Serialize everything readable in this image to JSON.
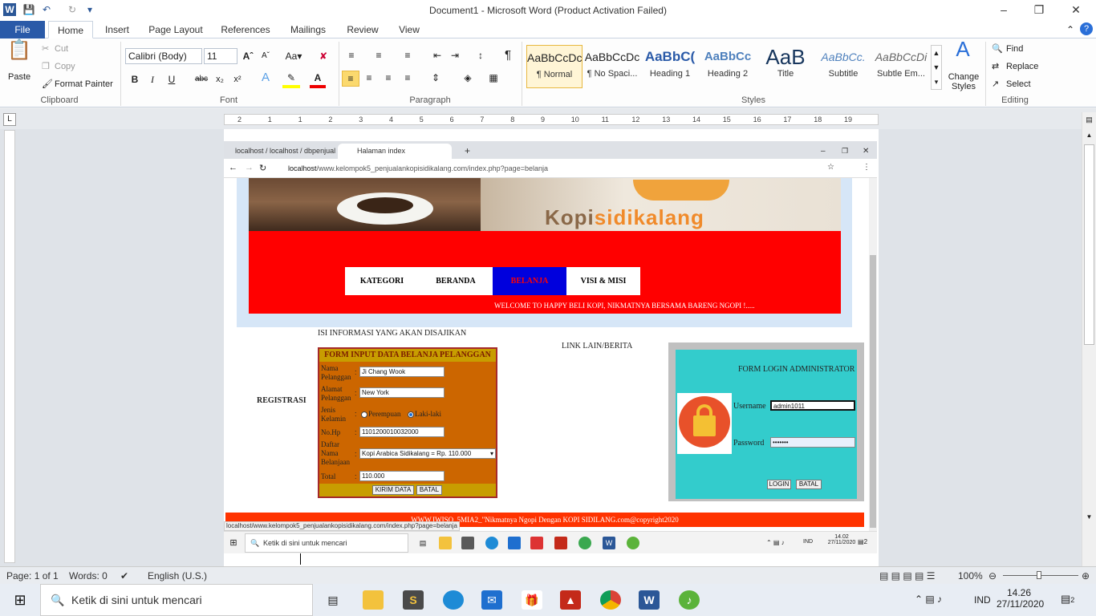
{
  "word": {
    "window_title": "Document1 - Microsoft Word (Product Activation Failed)",
    "tabs": [
      "File",
      "Home",
      "Insert",
      "Page Layout",
      "References",
      "Mailings",
      "Review",
      "View"
    ],
    "clipboard": {
      "paste": "Paste",
      "cut": "Cut",
      "copy": "Copy",
      "format_painter": "Format Painter",
      "group": "Clipboard"
    },
    "font": {
      "name": "Calibri (Body)",
      "size": "11",
      "group": "Font"
    },
    "paragraph": {
      "group": "Paragraph"
    },
    "styles": {
      "items": [
        {
          "preview": "AaBbCcDc",
          "name": "¶ Normal"
        },
        {
          "preview": "AaBbCcDc",
          "name": "¶ No Spaci..."
        },
        {
          "preview": "AaBbC(",
          "name": "Heading 1"
        },
        {
          "preview": "AaBbCc",
          "name": "Heading 2"
        },
        {
          "preview": "AaB",
          "name": "Title"
        },
        {
          "preview": "AaBbCc.",
          "name": "Subtitle"
        },
        {
          "preview": "AaBbCcDi",
          "name": "Subtle Em..."
        }
      ],
      "change_styles": "Change Styles",
      "group": "Styles"
    },
    "editing": {
      "find": "Find",
      "replace": "Replace",
      "select": "Select",
      "group": "Editing"
    },
    "ruler_numbers": [
      "2",
      "1",
      "1",
      "2",
      "3",
      "4",
      "5",
      "6",
      "7",
      "8",
      "9",
      "10",
      "11",
      "12",
      "13",
      "14",
      "15",
      "16",
      "17",
      "18",
      "19"
    ],
    "status": {
      "page": "Page: 1 of 1",
      "words": "Words: 0",
      "language": "English (U.S.)",
      "zoom": "100%"
    }
  },
  "browser": {
    "tabs": [
      "localhost / localhost / dbpenjual",
      "Halaman index"
    ],
    "url_host": "localhost",
    "url_path": "/www.kelompok5_penjualankopisidikalang.com/index.php?page=belanja",
    "status_url": "localhost/www.kelompok5_penjualankopisidikalang.com/index.php?page=belanja"
  },
  "site": {
    "logo_text_part1": "Kopi",
    "logo_text_part2": "sidikalang",
    "nav": [
      "KATEGORI",
      "BERANDA",
      "BELANJA",
      "VISI & MISI"
    ],
    "welcome": "WELCOME TO HAPPY BELI KOPI, NIKMATNYA BERSAMA BARENG NGOPI !.....",
    "info_heading": "ISI INFORMASI YANG AKAN DISAJIKAN",
    "link_lain": "LINK LAIN/BERITA",
    "registrasi": "REGISTRASI",
    "form": {
      "title": "FORM INPUT DATA BELANJA PELANGGAN",
      "nama_label": "Nama Pelanggan",
      "nama_value": "Ji Chang Wook",
      "alamat_label": "Alamat Pelanggan",
      "alamat_value": "New York",
      "jk_label": "Jenis Kelamin",
      "jk_opt1": "Perempuan",
      "jk_opt2": "Laki-laki",
      "hp_label": "No.Hp",
      "hp_value": "1101200010032000",
      "barang_label": "Daftar Nama Belanjaan",
      "barang_value": "Kopi Arabica Sidikalang = Rp. 110.000",
      "total_label": "Total",
      "total_value": "110.000",
      "submit": "KIRIM DATA",
      "cancel": "BATAL"
    },
    "login": {
      "title": "FORM LOGIN ADMINISTRATOR",
      "username_label": "Username",
      "username_value": "admin1011",
      "password_label": "Password",
      "password_value": "•••••••",
      "login_btn": "LOGIN",
      "cancel_btn": "BATAL"
    },
    "footer": "WWW.IWISO_5MIA2_\"Nikmatnya Ngopi Dengan KOPI SIDILANG.com@copyright2020"
  },
  "inner_taskbar": {
    "search": "Ketik di sini untuk mencari",
    "lang": "IND",
    "time": "14.02",
    "date": "27/11/2020",
    "notif": "2"
  },
  "taskbar": {
    "search": "Ketik di sini untuk mencari",
    "lang": "IND",
    "time": "14.26",
    "date": "27/11/2020",
    "notif": "2"
  }
}
